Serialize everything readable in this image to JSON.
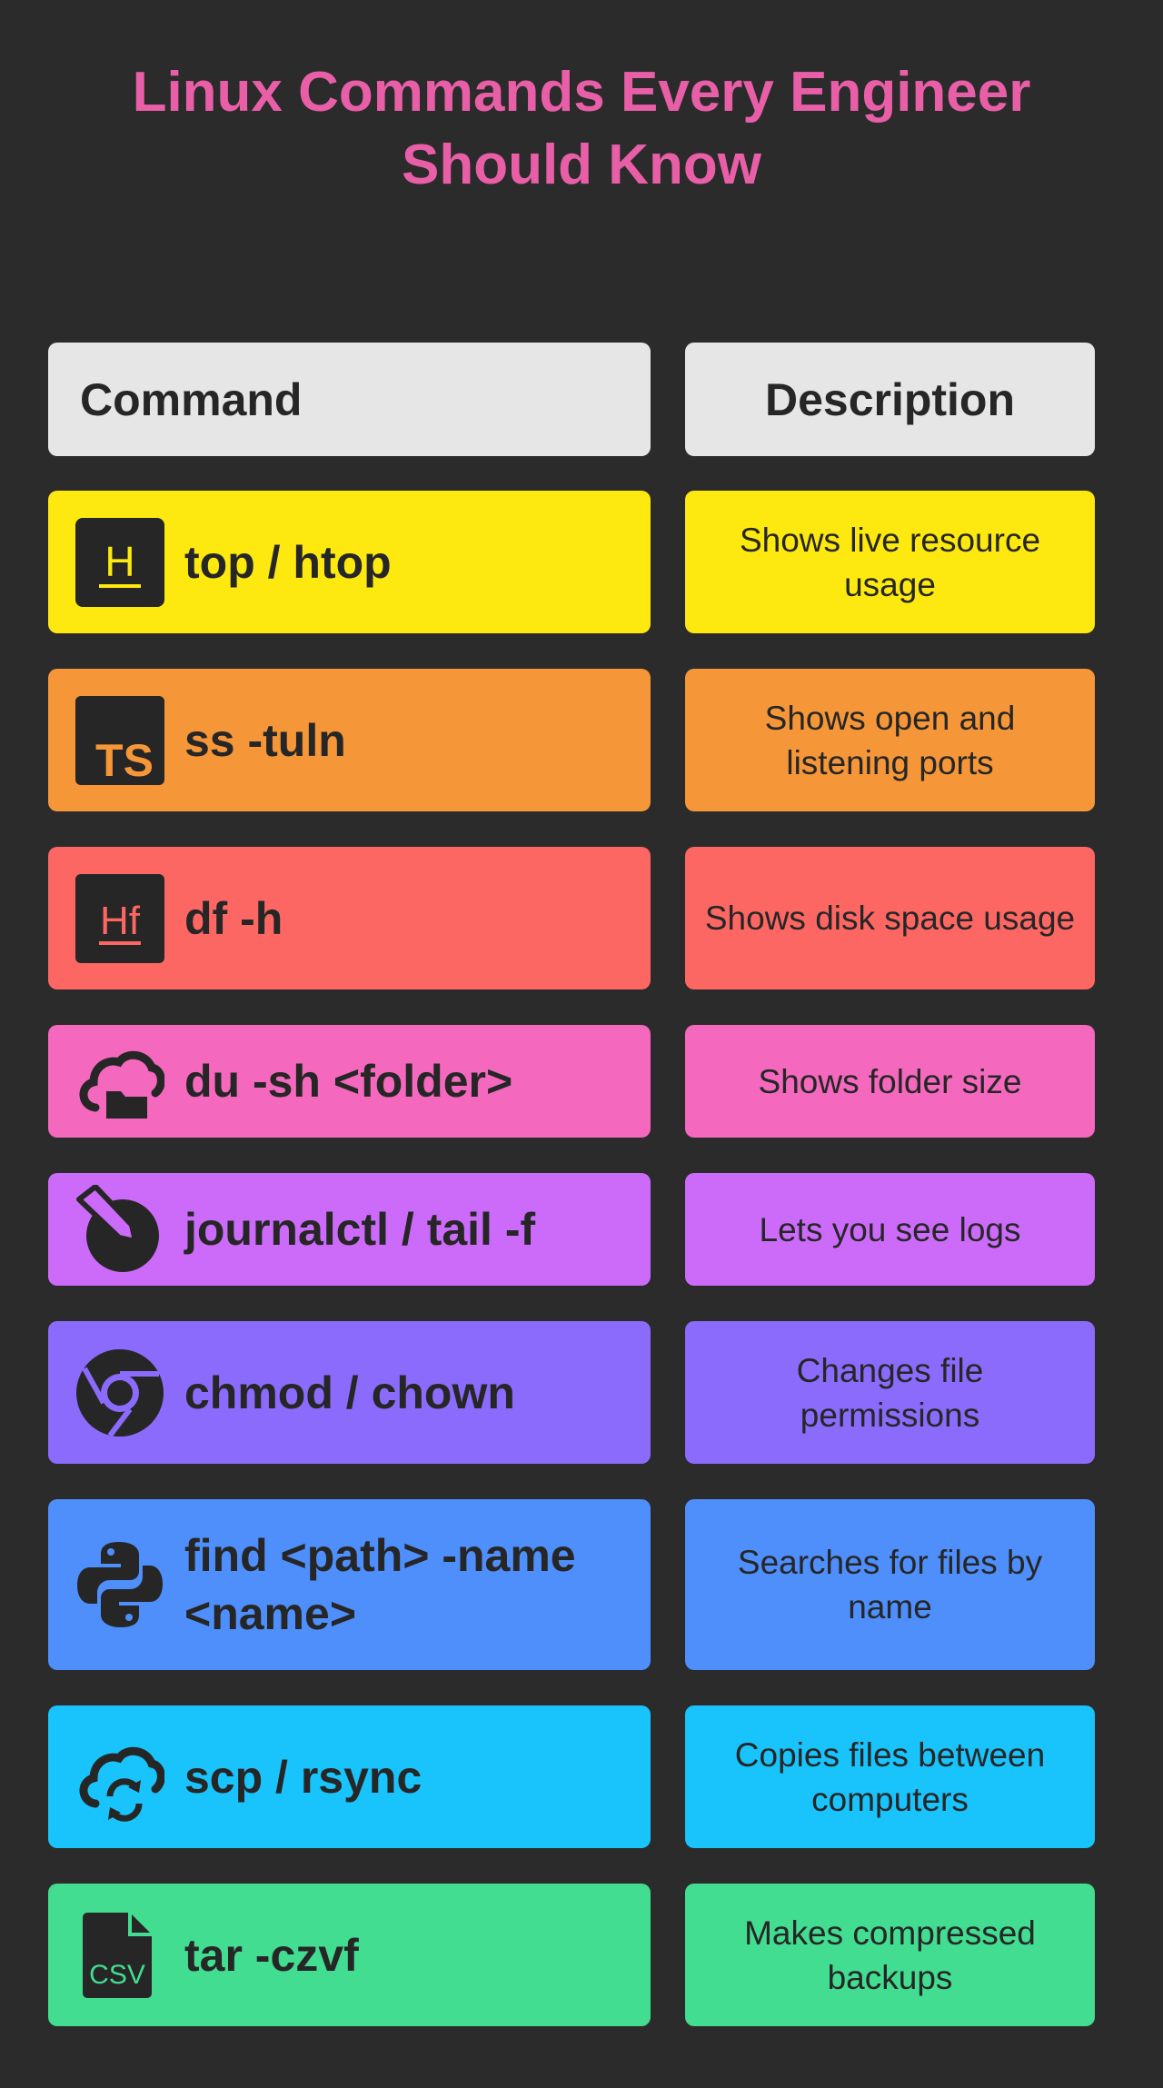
{
  "title": "Linux Commands Every Engineer Should Know",
  "header": {
    "command": "Command",
    "description": "Description"
  },
  "rows": [
    {
      "command": "top / htop",
      "description": "Shows live resource usage",
      "color": "#fde910",
      "icon": "htop-icon"
    },
    {
      "command": "ss -tuln",
      "description": "Shows open and listening ports",
      "color": "#f59638",
      "icon": "typescript-icon"
    },
    {
      "command": "df -h",
      "description": "Shows disk space usage",
      "color": "#fd6763",
      "icon": "hf-icon"
    },
    {
      "command": "du -sh <folder>",
      "description": "Shows folder size",
      "color": "#f468be",
      "icon": "cloud-folder-icon"
    },
    {
      "command": "journalctl / tail -f",
      "description": "Lets you see logs",
      "color": "#cc6bfa",
      "icon": "log-pencil-icon"
    },
    {
      "command": "chmod / chown",
      "description": "Changes file permissions",
      "color": "#8a6bfb",
      "icon": "chrome-icon"
    },
    {
      "command": "find <path> -name <name>",
      "description": "Searches for files by name",
      "color": "#4e8ffb",
      "icon": "python-icon"
    },
    {
      "command": "scp / rsync",
      "description": "Copies files between computers",
      "color": "#19c3fb",
      "icon": "cloud-sync-icon"
    },
    {
      "command": "tar -czvf",
      "description": "Makes compressed backups",
      "color": "#42dd91",
      "icon": "csv-file-icon"
    }
  ]
}
